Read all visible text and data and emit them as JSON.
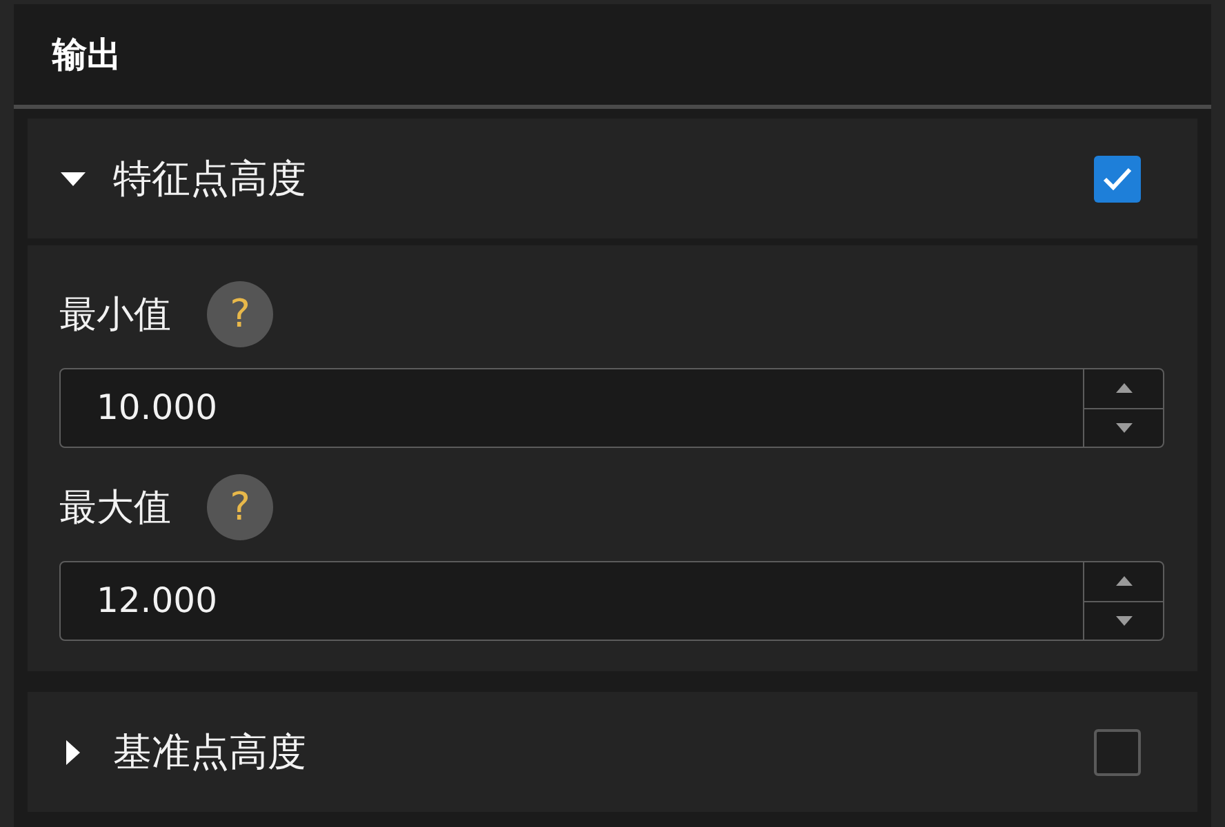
{
  "panel": {
    "title": "输出"
  },
  "sections": [
    {
      "title": "特征点高度",
      "expanded": true,
      "checked": true,
      "fields": [
        {
          "label": "最小值",
          "help": "?",
          "value": "10.000"
        },
        {
          "label": "最大值",
          "help": "?",
          "value": "12.000"
        }
      ]
    },
    {
      "title": "基准点高度",
      "expanded": false,
      "checked": false
    }
  ]
}
